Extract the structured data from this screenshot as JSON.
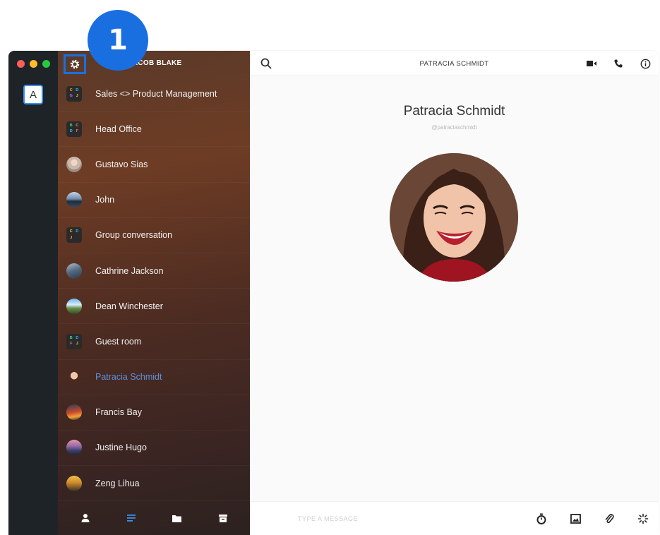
{
  "step_badge": "1",
  "current_user": {
    "name": "JACOB BLAKE"
  },
  "workspace": {
    "letter": "A"
  },
  "conversations": [
    {
      "name": "Sales <> Product Management",
      "avatar": "group",
      "letters": [
        "C",
        "D",
        "G",
        "J"
      ]
    },
    {
      "name": "Head Office",
      "avatar": "group",
      "letters": [
        "B",
        "C",
        "D",
        "F"
      ]
    },
    {
      "name": "Gustavo Sias",
      "avatar": "photo"
    },
    {
      "name": "John",
      "avatar": "photo"
    },
    {
      "name": "Group conversation",
      "avatar": "group",
      "letters": [
        "C",
        "D",
        "J",
        ""
      ]
    },
    {
      "name": "Cathrine Jackson",
      "avatar": "photo"
    },
    {
      "name": "Dean Winchester",
      "avatar": "photo"
    },
    {
      "name": "Guest room",
      "avatar": "group",
      "letters": [
        "B",
        "D",
        "F",
        "J"
      ]
    },
    {
      "name": "Patracia Schmidt",
      "avatar": "photo",
      "active": true
    },
    {
      "name": "Francis Bay",
      "avatar": "photo"
    },
    {
      "name": "Justine Hugo",
      "avatar": "photo"
    },
    {
      "name": "Zeng Lihua",
      "avatar": "photo"
    }
  ],
  "footer_icons": [
    "person-icon",
    "conversations-icon",
    "folder-icon",
    "archive-icon"
  ],
  "chat": {
    "title": "PATRACIA SCHMIDT",
    "profile_name": "Patracia Schmidt",
    "profile_handle": "@patraciaschmidt"
  },
  "top_actions": [
    "video-camera-icon",
    "phone-icon",
    "info-icon"
  ],
  "composer": {
    "placeholder": "TYPE A MESSAGE",
    "actions": [
      "timer-icon",
      "image-icon",
      "paperclip-icon",
      "ping-icon"
    ]
  },
  "colors": {
    "accent": "#1a6fe0",
    "active_conversation": "#5e8fd6",
    "rail": "#1e2328"
  }
}
